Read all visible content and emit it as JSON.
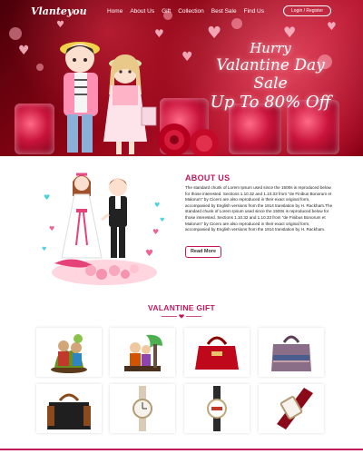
{
  "header": {
    "logo": "Vlanteyou",
    "menu": [
      "Home",
      "About Us",
      "Gift",
      "Collection",
      "Best Sale",
      "Find Us"
    ],
    "login_label": "Login / Register"
  },
  "hero": {
    "line1": "Hurry",
    "line2": "Valantine Day",
    "line3": "Sale",
    "line4": "Up To 80% Off"
  },
  "about": {
    "title": "ABOUT US",
    "text": "The standard chunk of Lorem Ipsum used since the 1500s is reproduced below for those interested. Sections 1.10.32 and 1.10.33 from \"de Finibus Bonorum et Malorum\" by Cicero are also reproduced in their exact original form, accompanied by English versions from the 1914 translation by H. Rackham.The standard chunk of Lorem Ipsum used since the 1500s is reproduced below for those interested. Sections 1.10.32 and 1.10.33 from \"de Finibus Bonorum et Malorum\" by Cicero are also reproduced in their exact original form, accompanied by English versions from the 1914 translation by H. Rackham.",
    "button_label": "Read More"
  },
  "gift": {
    "title": "VALANTINE GIFT",
    "products": [
      {
        "name": "couple-figurine-icon"
      },
      {
        "name": "couple-on-bench-icon"
      },
      {
        "name": "red-handbag-icon"
      },
      {
        "name": "purple-handbag-icon"
      },
      {
        "name": "black-handbag-icon"
      },
      {
        "name": "silver-watch-icon"
      },
      {
        "name": "black-strap-watch-icon"
      },
      {
        "name": "red-strap-watch-icon"
      }
    ]
  },
  "colors": {
    "accent": "#c2185b",
    "hero_red": "#8c0414"
  }
}
